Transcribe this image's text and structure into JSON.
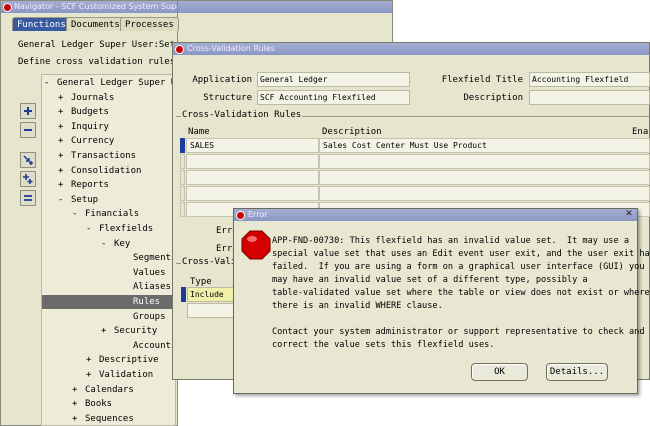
{
  "navigator": {
    "title": "Navigator - SCF Customized System Super User",
    "tabs": [
      "Functions",
      "Documents",
      "Processes"
    ],
    "responsibility": "General Ledger Super User:Setup:",
    "function_name": "Define cross validation rules",
    "tree": [
      {
        "toggle": "-",
        "label": "General Ledger Super Use",
        "level": 0
      },
      {
        "toggle": "+",
        "label": "Journals",
        "level": 1
      },
      {
        "toggle": "+",
        "label": "Budgets",
        "level": 1
      },
      {
        "toggle": "+",
        "label": "Inquiry",
        "level": 1
      },
      {
        "toggle": "+",
        "label": "Currency",
        "level": 1
      },
      {
        "toggle": "+",
        "label": "Transactions",
        "level": 1
      },
      {
        "toggle": "+",
        "label": "Consolidation",
        "level": 1
      },
      {
        "toggle": "+",
        "label": "Reports",
        "level": 1
      },
      {
        "toggle": "-",
        "label": "Setup",
        "level": 1
      },
      {
        "toggle": "-",
        "label": "Financials",
        "level": 2
      },
      {
        "toggle": "-",
        "label": "Flexfields",
        "level": 3
      },
      {
        "toggle": "-",
        "label": "Key",
        "level": 4
      },
      {
        "toggle": "",
        "label": "Segments",
        "level": 5
      },
      {
        "toggle": "",
        "label": "Values",
        "level": 5
      },
      {
        "toggle": "",
        "label": "Aliases",
        "level": 5
      },
      {
        "toggle": "",
        "label": "Rules",
        "level": 5,
        "selected": true
      },
      {
        "toggle": "",
        "label": "Groups",
        "level": 5
      },
      {
        "toggle": "+",
        "label": "Security",
        "level": 4
      },
      {
        "toggle": "",
        "label": "Accounts",
        "level": 5
      },
      {
        "toggle": "+",
        "label": "Descriptive",
        "level": 3
      },
      {
        "toggle": "+",
        "label": "Validation",
        "level": 3
      },
      {
        "toggle": "+",
        "label": "Calendars",
        "level": 2
      },
      {
        "toggle": "+",
        "label": "Books",
        "level": 2
      },
      {
        "toggle": "+",
        "label": "Sequences",
        "level": 2
      }
    ],
    "toolbar_icons": [
      "expand-icon",
      "collapse-icon",
      "expand-branch-icon",
      "expand-all-icon",
      "collapse-all-icon"
    ]
  },
  "cvr": {
    "title": "Cross-Validation Rules",
    "application_label": "Application",
    "application_value": "General Ledger",
    "structure_label": "Structure",
    "structure_value": "SCF Accounting Flexfiled",
    "flexfield_title_label": "Flexfield Title",
    "flexfield_title_value": "Accounting Flexfield",
    "description_label": "Description",
    "description_value": "",
    "section_rules": "Cross-Validation Rules",
    "col_name": "Name",
    "col_description": "Description",
    "col_enabled": "Ena",
    "rows": [
      {
        "name": "SALES",
        "description": "Sales Cost Center Must Use Product"
      },
      {
        "name": "",
        "description": ""
      },
      {
        "name": "",
        "description": ""
      },
      {
        "name": "",
        "description": ""
      },
      {
        "name": "",
        "description": ""
      }
    ],
    "error_label_1": "Erro",
    "error_label_2": "Erro",
    "section_elements": "Cross-Vali",
    "col_type": "Type",
    "type_value": "Include"
  },
  "error": {
    "title": "Error",
    "message": "APP-FND-00730: This flexfield has an invalid value set.  It may use a\nspecial value set that uses an Edit event user exit, and the user exit has\nfailed.  If you are using a form on a graphical user interface (GUI) you\nmay have an invalid value set of a different type, possibly a\ntable-validated value set where the table or view does not exist or where\nthere is an invalid WHERE clause.\n\nContact your system administrator or support representative to check and\ncorrect the value sets this flexfield uses.",
    "ok_label": "OK",
    "details_label": "Details..."
  }
}
